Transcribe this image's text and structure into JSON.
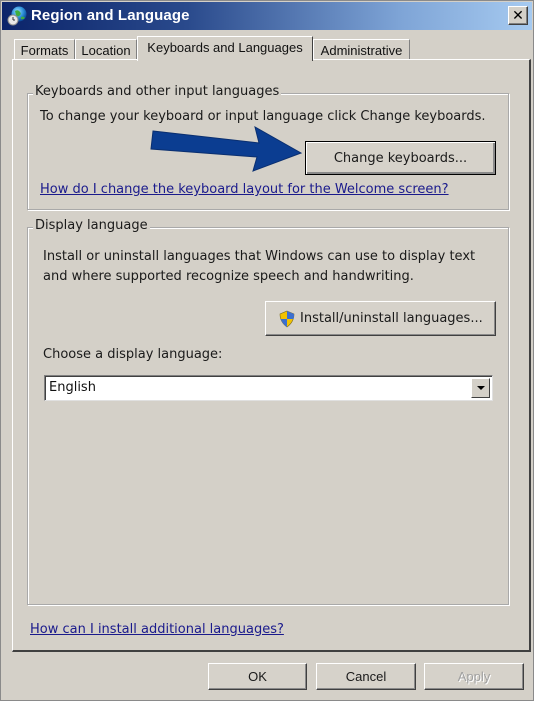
{
  "window": {
    "title": "Region and Language",
    "close_label": "✕"
  },
  "tabs": [
    {
      "label": "Formats",
      "active": false
    },
    {
      "label": "Location",
      "active": false
    },
    {
      "label": "Keyboards and Languages",
      "active": true
    },
    {
      "label": "Administrative",
      "active": false
    }
  ],
  "keyboards_group": {
    "legend": "Keyboards and other input languages",
    "description": "To change your keyboard or input language click Change keyboards.",
    "change_button": "Change keyboards...",
    "welcome_link": "How do I change the keyboard layout for the Welcome screen?"
  },
  "display_group": {
    "legend": "Display language",
    "description_line1": "Install or uninstall languages that Windows can use to display text",
    "description_line2": "and where supported recognize speech and handwriting.",
    "install_button": "Install/uninstall languages...",
    "choose_label": "Choose a display language:",
    "language_select": {
      "value": "English"
    }
  },
  "additional_link": "How can I install additional languages?",
  "footer": {
    "ok": "OK",
    "cancel": "Cancel",
    "apply": "Apply",
    "apply_disabled": true
  },
  "annotation": {
    "arrow_color": "#0b3d91",
    "arrow_points_to": "Change keyboards..."
  }
}
